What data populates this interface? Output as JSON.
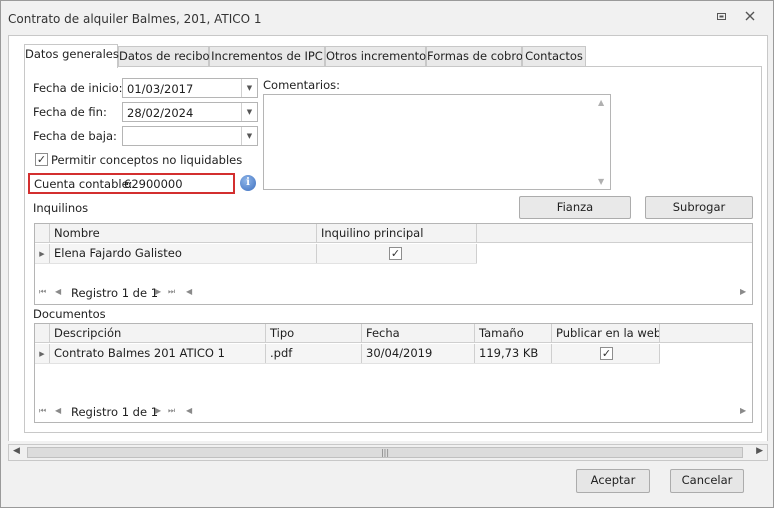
{
  "window": {
    "title": "Contrato de alquiler Balmes, 201, ATICO 1",
    "restore_icon": "restore-icon",
    "close_icon": "close-icon"
  },
  "tabs": [
    {
      "label": "Datos generales",
      "active": true
    },
    {
      "label": "Datos de recibo",
      "active": false
    },
    {
      "label": "Incrementos de IPC",
      "active": false
    },
    {
      "label": "Otros incrementos",
      "active": false
    },
    {
      "label": "Formas de cobro",
      "active": false
    },
    {
      "label": "Contactos",
      "active": false
    }
  ],
  "form": {
    "fecha_inicio_label": "Fecha de inicio:",
    "fecha_inicio_value": "01/03/2017",
    "fecha_fin_label": "Fecha de fin:",
    "fecha_fin_value": "28/02/2024",
    "fecha_baja_label": "Fecha de baja:",
    "fecha_baja_value": "",
    "permitir_label": "Permitir conceptos no liquidables",
    "permitir_checked": true,
    "cuenta_label": "Cuenta contable:",
    "cuenta_value": "62900000",
    "comentarios_label": "Comentarios:",
    "comentarios_value": ""
  },
  "inquilinos": {
    "section_label": "Inquilinos",
    "fianza_button": "Fianza",
    "subrogar_button": "Subrogar",
    "columns": [
      "Nombre",
      "Inquilino principal"
    ],
    "rows": [
      {
        "nombre": "Elena Fajardo Galisteo",
        "principal": true
      }
    ],
    "nav_text": "Registro 1 de 1"
  },
  "documentos": {
    "section_label": "Documentos",
    "columns": [
      "Descripción",
      "Tipo",
      "Fecha",
      "Tamaño",
      "Publicar en la web"
    ],
    "rows": [
      {
        "descripcion": "Contrato Balmes 201 ATICO 1",
        "tipo": ".pdf",
        "fecha": "30/04/2019",
        "tamano": "119,73 KB",
        "publicar": true
      }
    ],
    "nav_text": "Registro 1 de 1"
  },
  "footer": {
    "aceptar": "Aceptar",
    "cancelar": "Cancelar"
  },
  "colors": {
    "highlight_border": "#d32f2f",
    "info_icon": "#3d6fbf"
  }
}
